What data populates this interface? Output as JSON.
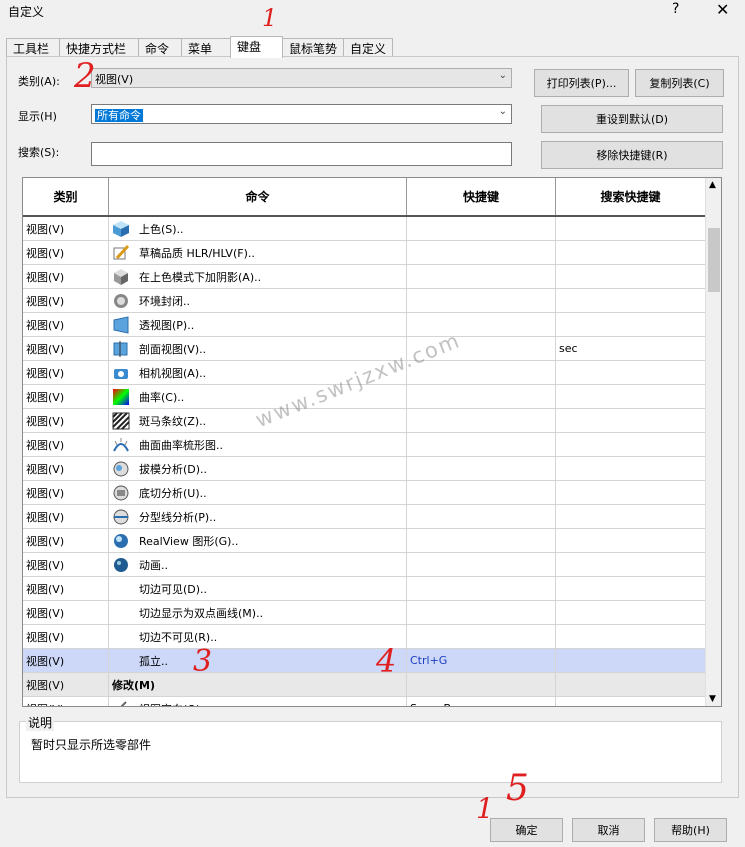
{
  "window": {
    "title": "自定义",
    "help": "?",
    "close": "✕"
  },
  "tabs": [
    "工具栏",
    "快捷方式栏",
    "命令",
    "菜单",
    "键盘",
    "鼠标笔势",
    "自定义"
  ],
  "active_tab": "键盘",
  "form": {
    "category_label": "类别(A):",
    "category_value": "视图(V)",
    "show_label": "显示(H)",
    "show_value": "所有命令",
    "search_label": "搜索(S):",
    "search_value": ""
  },
  "buttons": {
    "print": "打印列表(P)...",
    "copy": "复制列表(C)",
    "reset": "重设到默认(D)",
    "remove": "移除快捷键(R)",
    "ok": "确定",
    "cancel": "取消",
    "help": "帮助(H)"
  },
  "table": {
    "columns": [
      "类别",
      "命令",
      "快捷键",
      "搜索快捷键"
    ],
    "rows": [
      {
        "cat": "视图(V)",
        "icon": "shaded-cube-icon",
        "cmd": "上色(S)..",
        "key": "",
        "search": ""
      },
      {
        "cat": "视图(V)",
        "icon": "draft-quality-icon",
        "cmd": "草稿品质 HLR/HLV(F)..",
        "key": "",
        "search": ""
      },
      {
        "cat": "视图(V)",
        "icon": "shadows-icon",
        "cmd": "在上色模式下加阴影(A)..",
        "key": "",
        "search": ""
      },
      {
        "cat": "视图(V)",
        "icon": "ambient-occlusion-icon",
        "cmd": "环境封闭..",
        "key": "",
        "search": ""
      },
      {
        "cat": "视图(V)",
        "icon": "perspective-icon",
        "cmd": "透视图(P)..",
        "key": "",
        "search": ""
      },
      {
        "cat": "视图(V)",
        "icon": "section-view-icon",
        "cmd": "剖面视图(V)..",
        "key": "",
        "search": "sec"
      },
      {
        "cat": "视图(V)",
        "icon": "camera-view-icon",
        "cmd": "相机视图(A)..",
        "key": "",
        "search": ""
      },
      {
        "cat": "视图(V)",
        "icon": "curvature-icon",
        "cmd": "曲率(C)..",
        "key": "",
        "search": ""
      },
      {
        "cat": "视图(V)",
        "icon": "zebra-stripes-icon",
        "cmd": "斑马条纹(Z)..",
        "key": "",
        "search": ""
      },
      {
        "cat": "视图(V)",
        "icon": "curvature-comb-icon",
        "cmd": "曲面曲率梳形图..",
        "key": "",
        "search": ""
      },
      {
        "cat": "视图(V)",
        "icon": "draft-analysis-icon",
        "cmd": "拔模分析(D)..",
        "key": "",
        "search": ""
      },
      {
        "cat": "视图(V)",
        "icon": "undercut-analysis-icon",
        "cmd": "底切分析(U)..",
        "key": "",
        "search": ""
      },
      {
        "cat": "视图(V)",
        "icon": "parting-line-analysis-icon",
        "cmd": "分型线分析(P)..",
        "key": "",
        "search": ""
      },
      {
        "cat": "视图(V)",
        "icon": "realview-icon",
        "cmd": "RealView 图形(G)..",
        "key": "",
        "search": ""
      },
      {
        "cat": "视图(V)",
        "icon": "animation-icon",
        "cmd": "动画..",
        "key": "",
        "search": ""
      },
      {
        "cat": "视图(V)",
        "icon": "",
        "cmd": "切边可见(D)..",
        "key": "",
        "search": ""
      },
      {
        "cat": "视图(V)",
        "icon": "",
        "cmd": "切边显示为双点画线(M)..",
        "key": "",
        "search": ""
      },
      {
        "cat": "视图(V)",
        "icon": "",
        "cmd": "切边不可见(R)..",
        "key": "",
        "search": ""
      },
      {
        "cat": "视图(V)",
        "icon": "",
        "cmd": "孤立..",
        "key": "Ctrl+G",
        "search": "",
        "selected": true
      },
      {
        "cat": "视图(V)",
        "icon": "",
        "cmd": "修改(M)",
        "key": "",
        "search": "",
        "group": true
      },
      {
        "cat": "视图(V)",
        "icon": "view-orientation-icon",
        "cmd": "视图定向(O)..",
        "key": "SpaceBar",
        "search": ""
      }
    ]
  },
  "description": {
    "legend": "说明",
    "text": "暂时只显示所选零部件"
  },
  "watermark": "www.swrjzxw.com",
  "annotations": [
    "1",
    "2",
    "3",
    "4",
    "5"
  ],
  "colors": {
    "selected_row": "#cdd8f9",
    "selection": "#0078d7",
    "annotation": "#e02020"
  }
}
